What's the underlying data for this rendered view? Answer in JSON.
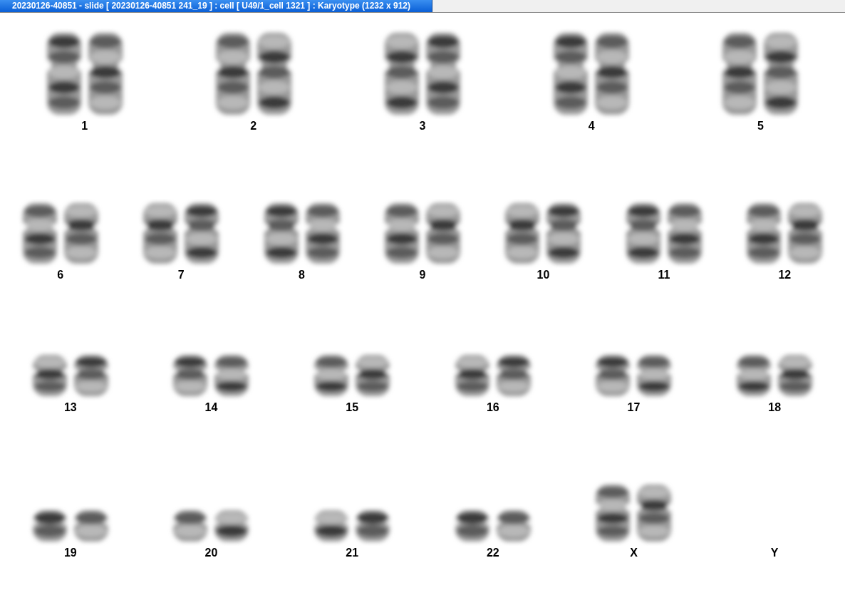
{
  "window": {
    "title": "20230126-40851 - slide [ 20230126-40851 241_19 ] : cell [ U49/1_cell 1321 ] : Karyotype  (1232 x 912)"
  },
  "karyotype": {
    "rows": [
      {
        "pairs": [
          {
            "label": "1",
            "empty": false
          },
          {
            "label": "2",
            "empty": false
          },
          {
            "label": "3",
            "empty": false
          },
          {
            "label": "4",
            "empty": false
          },
          {
            "label": "5",
            "empty": false
          }
        ]
      },
      {
        "pairs": [
          {
            "label": "6",
            "empty": false
          },
          {
            "label": "7",
            "empty": false
          },
          {
            "label": "8",
            "empty": false
          },
          {
            "label": "9",
            "empty": false
          },
          {
            "label": "10",
            "empty": false
          },
          {
            "label": "11",
            "empty": false
          },
          {
            "label": "12",
            "empty": false
          }
        ]
      },
      {
        "pairs": [
          {
            "label": "13",
            "empty": false
          },
          {
            "label": "14",
            "empty": false
          },
          {
            "label": "15",
            "empty": false
          },
          {
            "label": "16",
            "empty": false
          },
          {
            "label": "17",
            "empty": false
          },
          {
            "label": "18",
            "empty": false
          }
        ]
      },
      {
        "pairs": [
          {
            "label": "19",
            "empty": false
          },
          {
            "label": "20",
            "empty": false
          },
          {
            "label": "21",
            "empty": false
          },
          {
            "label": "22",
            "empty": false
          },
          {
            "label": "X",
            "empty": false
          },
          {
            "label": "Y",
            "empty": true
          }
        ]
      }
    ]
  }
}
